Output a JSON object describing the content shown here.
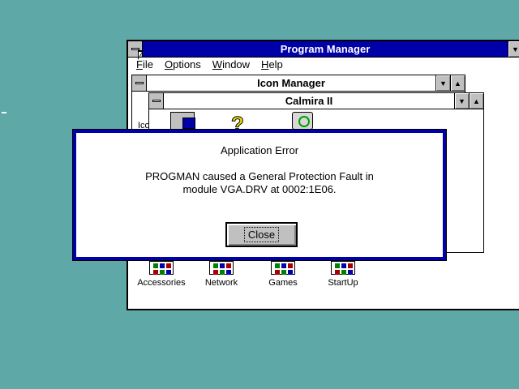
{
  "program_manager": {
    "title": "Program Manager",
    "menu": [
      {
        "label_first": "F",
        "label_rest": "ile"
      },
      {
        "label_first": "O",
        "label_rest": "ptions"
      },
      {
        "label_first": "W",
        "label_rest": "indow"
      },
      {
        "label_first": "H",
        "label_rest": "elp"
      }
    ],
    "scroll_down_glyph": "▼",
    "groups": [
      {
        "label": "Accessories"
      },
      {
        "label": "Network"
      },
      {
        "label": "Games"
      },
      {
        "label": "StartUp"
      }
    ]
  },
  "icon_manager": {
    "title": "Icon Manager",
    "partial_label": "Ico",
    "min_glyph": "▼",
    "max_glyph": "▲"
  },
  "calmira": {
    "title": "Calmira II",
    "min_glyph": "▼",
    "max_glyph": "▲"
  },
  "error_dialog": {
    "title": "Application Error",
    "message_line1": "PROGMAN caused a General Protection Fault in",
    "message_line2": "module VGA.DRV at 0002:1E06.",
    "close_label": "Close"
  },
  "colors": {
    "desktop": "#5fa8a8",
    "active_title": "#0000a8",
    "dialog_border": "#0000a8"
  }
}
